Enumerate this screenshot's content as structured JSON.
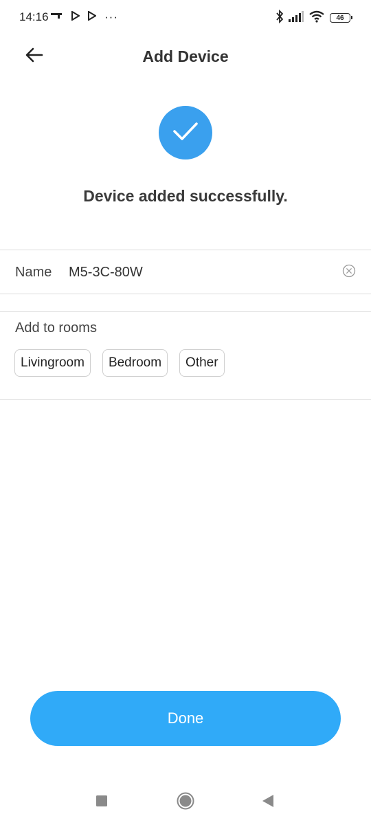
{
  "status_bar": {
    "time": "14:16",
    "overflow": "···",
    "battery_level": "46",
    "icons": [
      "key-icon",
      "play-store-icon",
      "play-store-icon",
      "bluetooth-icon",
      "signal-icon",
      "wifi-icon",
      "battery-icon"
    ]
  },
  "header": {
    "title": "Add Device",
    "back_icon": "back-arrow-icon"
  },
  "success": {
    "icon": "checkmark-icon",
    "message": "Device added successfully."
  },
  "name_field": {
    "label": "Name",
    "value": "M5-3C-80W",
    "clear_icon": "clear-icon"
  },
  "rooms": {
    "title": "Add to rooms",
    "options": [
      "Livingroom",
      "Bedroom",
      "Other"
    ]
  },
  "done_button": {
    "label": "Done"
  },
  "nav_bar": {
    "icons": [
      "recents-icon",
      "home-icon",
      "back-icon"
    ]
  },
  "colors": {
    "accent": "#30aaf8",
    "success_circle": "#3aa0ee",
    "divider": "#dcdcdc",
    "text_primary": "#333333"
  }
}
